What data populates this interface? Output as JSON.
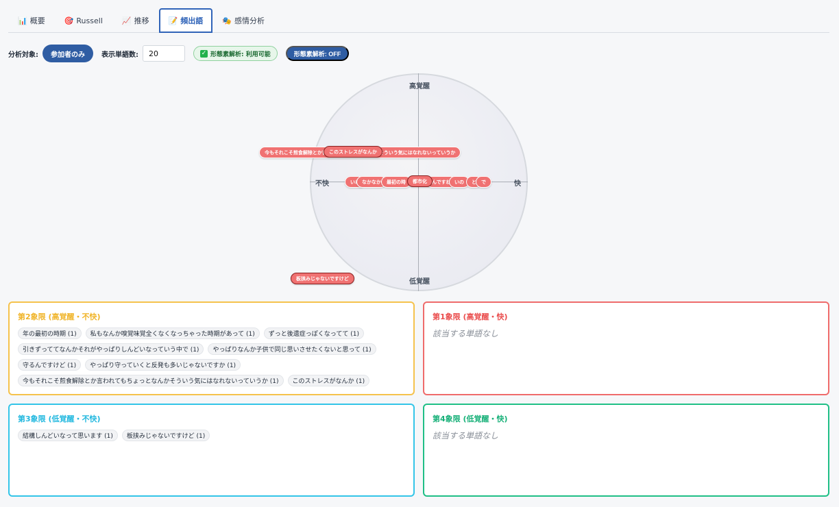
{
  "tabs": [
    {
      "icon": "📊",
      "label": "概要"
    },
    {
      "icon": "🎯",
      "label": "Russell"
    },
    {
      "icon": "📈",
      "label": "推移"
    },
    {
      "icon": "📝",
      "label": "頻出語"
    },
    {
      "icon": "🎭",
      "label": "感情分析"
    }
  ],
  "controls": {
    "target_label": "分析対象:",
    "target_value": "参加者のみ",
    "count_label": "表示単語数:",
    "count_value": "20",
    "morph_status": "形態素解析: 利用可能",
    "morph_toggle": "形態素解析: OFF"
  },
  "russell": {
    "axis_top": "高覚醒",
    "axis_bottom": "低覚醒",
    "axis_left": "不快",
    "axis_right": "快",
    "words": [
      "今もそれこそ煎食解除とか言われてもちょっとなんかそういう気にはなれないっていうか",
      "このストレスがなんか",
      "いわ",
      "なかなか",
      "最初の時",
      "んですね",
      "いの",
      "と",
      "で",
      "都市化",
      "板挟みじゃないですけど"
    ]
  },
  "quadrants": {
    "q2": {
      "title": "第2象限 (高覚醒・不快)",
      "items": [
        "年の最初の時期 (1)",
        "私もなんか嗅覚味覚全くなくなっちゃった時期があって (1)",
        "ずっと後遺症っぽくなってて (1)",
        "引きずっててなんかそれがやっぱりしんどいなっていう中で (1)",
        "やっぱりなんか子供で同じ思いさせたくないと思って (1)",
        "守るんですけど (1)",
        "やっぱり守っていくと反発も多いじゃないですか (1)",
        "今もそれこそ煎食解除とか言われてもちょっとなんかそういう気にはなれないっていうか (1)",
        "このストレスがなんか (1)"
      ]
    },
    "q1": {
      "title": "第1象限 (高覚醒・快)",
      "empty": "該当する単語なし"
    },
    "q3": {
      "title": "第3象限 (低覚醒・不快)",
      "items": [
        "結構しんどいなって思います (1)",
        "板挟みじゃないですけど (1)"
      ]
    },
    "q4": {
      "title": "第4象限 (低覚醒・快)",
      "empty": "該当する単語なし"
    }
  }
}
